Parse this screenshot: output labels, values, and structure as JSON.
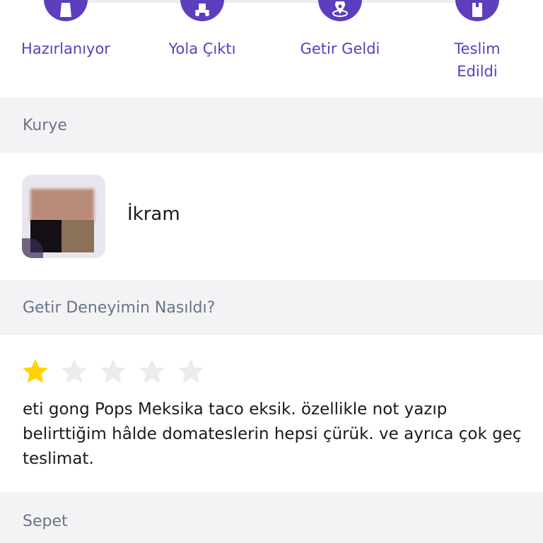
{
  "colors": {
    "accent": "#5d3ebc",
    "section_bg": "#f3f3f5",
    "section_text": "#697488",
    "star_filled": "#ffd300",
    "star_empty": "#ececef"
  },
  "tracker": {
    "steps": [
      {
        "label": "Hazırlanıyor",
        "icon": "bag-icon"
      },
      {
        "label": "Yola Çıktı",
        "icon": "scooter-icon"
      },
      {
        "label": "Getir Geldi",
        "icon": "location-pin-icon"
      },
      {
        "label": "Teslim\nEdildi",
        "icon": "package-icon"
      }
    ]
  },
  "courier": {
    "header": "Kurye",
    "name": "İkram"
  },
  "experience": {
    "header": "Getir Deneyimin Nasıldı?",
    "rating": 1,
    "max_rating": 5,
    "review": "eti gong Pops Meksika taco eksik. özellikle not yazıp belirttiğim hâlde domateslerin hepsi çürük. ve ayrıca çok geç teslimat."
  },
  "basket": {
    "header": "Sepet"
  }
}
